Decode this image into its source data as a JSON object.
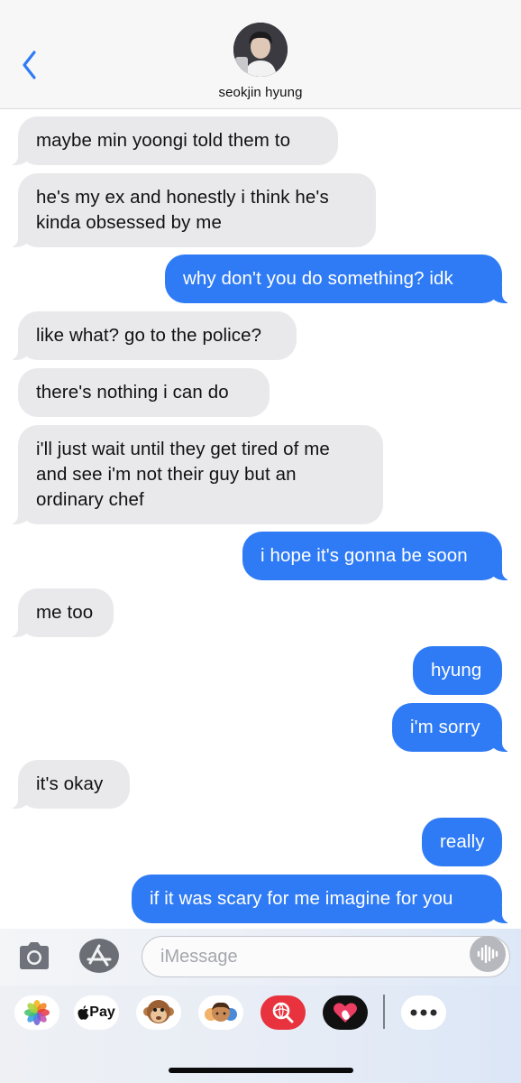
{
  "header": {
    "contact_name": "seokjin hyung",
    "icons": {
      "back": "chevron-left-icon",
      "avatar": "contact-avatar"
    }
  },
  "messages": [
    {
      "from": "them",
      "text": "maybe min yoongi told them to"
    },
    {
      "from": "them",
      "text": "he's my ex and honestly i think he's\nkinda obsessed by me"
    },
    {
      "from": "me",
      "text": "why don't you do something? idk"
    },
    {
      "from": "them",
      "text": "like what? go to the police?"
    },
    {
      "from": "them",
      "text": "there's nothing i can do"
    },
    {
      "from": "them",
      "text": "i'll just wait until they get tired of me\nand see i'm not their guy but an\nordinary chef"
    },
    {
      "from": "me",
      "text": "i hope it's gonna be soon"
    },
    {
      "from": "them",
      "text": "me too"
    },
    {
      "from": "me",
      "text": "hyung"
    },
    {
      "from": "me",
      "text": "i'm sorry"
    },
    {
      "from": "them",
      "text": "it's okay"
    },
    {
      "from": "me",
      "text": "really"
    },
    {
      "from": "me",
      "text": "if it was scary for me imagine for you"
    }
  ],
  "input": {
    "placeholder": "iMessage",
    "icons": [
      "camera-icon",
      "app-store-icon",
      "audio-waveform-icon"
    ]
  },
  "app_drawer": {
    "apple_pay_label": "Pay",
    "apps": [
      "photos-icon",
      "apple-pay-icon",
      "monkey-animoji-icon",
      "memoji-icon",
      "web-search-icon",
      "digital-touch-icon",
      "more-icon"
    ]
  },
  "colors": {
    "sent_bubble": "#2f7bf5",
    "received_bubble": "#e9e9eb",
    "accent": "#2f7bf5"
  }
}
